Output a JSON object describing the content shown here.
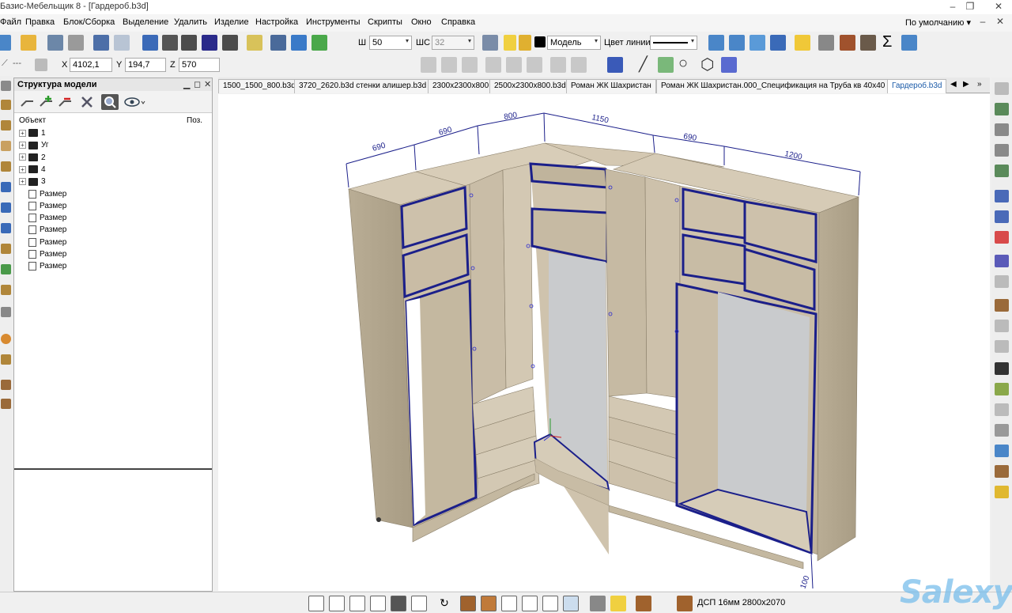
{
  "window": {
    "title": "Базис-Мебельщик 8 - [Гардероб.b3d]"
  },
  "menu": {
    "items": [
      "Файл",
      "Правка",
      "Блок/Сборка",
      "Выделение",
      "Удалить",
      "Изделие",
      "Настройка",
      "Инструменты",
      "Скрипты",
      "Окно",
      "Справка"
    ],
    "profile": "По умолчанию"
  },
  "toolbar": {
    "width_label": "Ш",
    "width_value": "50",
    "depth_label": "ШС",
    "depth_value": "32",
    "mode_value": "Модель",
    "line_color_label": "Цвет линии",
    "x_label": "X",
    "x_value": "4102,1",
    "y_label": "Y",
    "y_value": "194,7",
    "z_label": "Z",
    "z_value": "570",
    "line_style": "---"
  },
  "panel": {
    "title": "Структура модели",
    "col_object": "Объект",
    "col_pos": "Поз.",
    "tree": [
      {
        "label": "1",
        "type": "layer"
      },
      {
        "label": "Уг",
        "type": "layer"
      },
      {
        "label": "2",
        "type": "layer"
      },
      {
        "label": "4",
        "type": "layer"
      },
      {
        "label": "3",
        "type": "layer"
      },
      {
        "label": "Размер",
        "type": "dimension"
      },
      {
        "label": "Размер",
        "type": "dimension"
      },
      {
        "label": "Размер",
        "type": "dimension"
      },
      {
        "label": "Размер",
        "type": "dimension"
      },
      {
        "label": "Размер",
        "type": "dimension"
      },
      {
        "label": "Размер",
        "type": "dimension"
      },
      {
        "label": "Размер",
        "type": "dimension"
      }
    ]
  },
  "tabs": [
    {
      "label": "1500_1500_800.b3d",
      "active": false
    },
    {
      "label": "3720_2620.b3d стенки алишер.b3d",
      "active": false
    },
    {
      "label": "2300x2300x800",
      "active": false
    },
    {
      "label": "2500x2300x800.b3d",
      "active": false
    },
    {
      "label": "Роман ЖК Шахристан",
      "active": false
    },
    {
      "label": "Роман ЖК Шахристан.000_Спецификация на Труба кв 40x40",
      "active": false
    },
    {
      "label": "Гардероб.b3d",
      "active": true
    }
  ],
  "dimensions": {
    "left_depth": "690",
    "left_width": "690",
    "corner_a": "800",
    "corner_b": "1150",
    "right_depth": "690",
    "right_width": "1200",
    "plinth": "100"
  },
  "status": {
    "material": "ДСП 16мм 2800x2070"
  },
  "watermark": "Salexy",
  "colors": {
    "wood": "#cbbfa9",
    "wood_dark": "#b5a890",
    "edge": "#1b1f8a",
    "dim_line": "#1b1f8a",
    "mirror": "#c9cbcd"
  }
}
